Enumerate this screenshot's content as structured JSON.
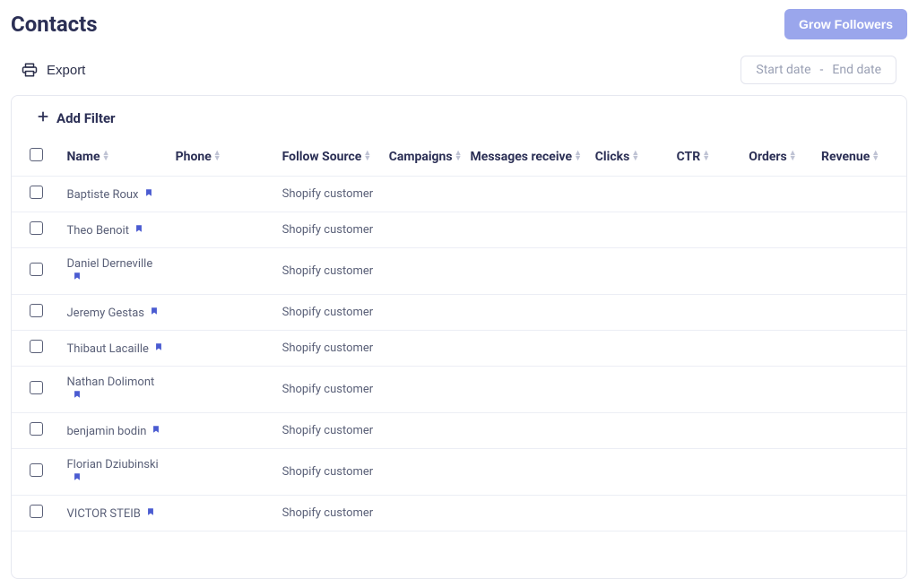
{
  "header": {
    "title": "Contacts",
    "grow_button": "Grow Followers"
  },
  "toolbar": {
    "export_label": "Export"
  },
  "date_range": {
    "start_placeholder": "Start date",
    "dash": "-",
    "end_placeholder": "End date"
  },
  "filter": {
    "add_label": "Add Filter"
  },
  "columns": {
    "name": "Name",
    "phone": "Phone",
    "follow_source": "Follow Source",
    "campaigns": "Campaigns",
    "messages_receive": "Messages receive",
    "clicks": "Clicks",
    "ctr": "CTR",
    "orders": "Orders",
    "revenue": "Revenue"
  },
  "rows": [
    {
      "name": "Baptiste Roux",
      "source": "Shopify customer"
    },
    {
      "name": "Theo Benoit",
      "source": "Shopify customer"
    },
    {
      "name": "Daniel Derneville",
      "source": "Shopify customer"
    },
    {
      "name": "Jeremy Gestas",
      "source": "Shopify customer"
    },
    {
      "name": "Thibaut Lacaille",
      "source": "Shopify customer"
    },
    {
      "name": "Nathan Dolimont",
      "source": "Shopify customer"
    },
    {
      "name": "benjamin bodin",
      "source": "Shopify customer"
    },
    {
      "name": "Florian Dziubinski",
      "source": "Shopify customer"
    },
    {
      "name": "VICTOR STEIB",
      "source": "Shopify customer"
    }
  ]
}
